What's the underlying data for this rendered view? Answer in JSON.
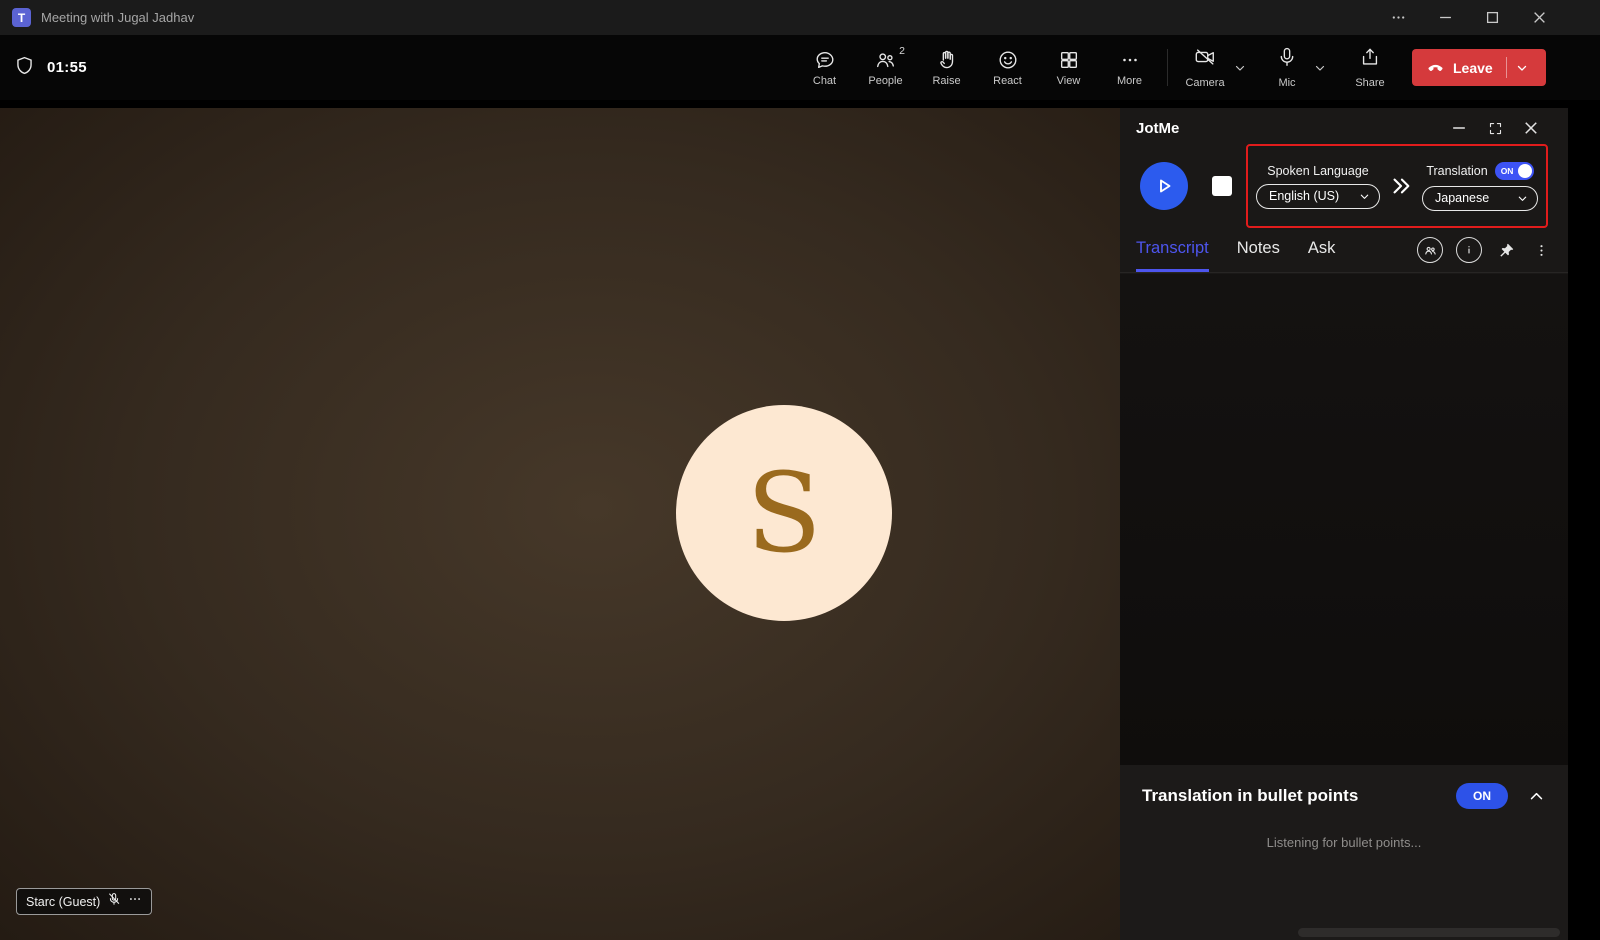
{
  "titlebar": {
    "title": "Meeting with Jugal Jadhav"
  },
  "toolbar": {
    "timer": "01:55",
    "chat": "Chat",
    "people": "People",
    "people_badge": "2",
    "raise": "Raise",
    "react": "React",
    "view": "View",
    "more": "More",
    "camera": "Camera",
    "mic": "Mic",
    "share": "Share",
    "leave": "Leave"
  },
  "stage": {
    "avatar_initial": "S",
    "participant": "Starc (Guest)"
  },
  "panel": {
    "title": "JotMe",
    "spoken_language_label": "Spoken Language",
    "spoken_language_value": "English (US)",
    "translation_label": "Translation",
    "translation_on": "ON",
    "translation_value": "Japanese",
    "tabs": {
      "transcript": "Transcript",
      "notes": "Notes",
      "ask": "Ask"
    },
    "bullets": {
      "title": "Translation in bullet points",
      "toggle": "ON",
      "status": "Listening for bullet points..."
    }
  },
  "colors": {
    "accent_blue": "#4d55ee",
    "play_button_blue": "#2c5bee",
    "toggle_blue": "#3d53f5",
    "leave_red": "#d53a3c",
    "annotation_red": "#e11c1c",
    "avatar_bg": "#fde8d2",
    "avatar_text": "#9a6a1e"
  }
}
